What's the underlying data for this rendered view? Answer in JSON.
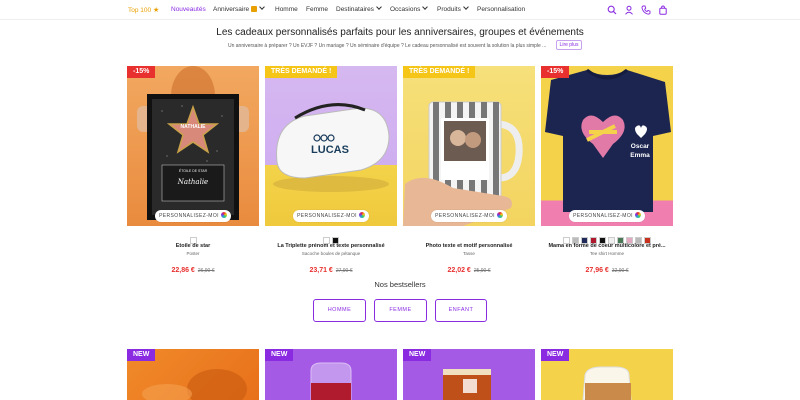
{
  "nav": {
    "top100": "Top 100",
    "new": "Nouveautés",
    "items": [
      "Anniversaire",
      "Homme",
      "Femme",
      "Destinataires",
      "Occasions",
      "Produits",
      "Personnalisation"
    ]
  },
  "icons": [
    "search-icon",
    "user-icon",
    "phone-icon",
    "cart-icon"
  ],
  "hero": {
    "title": "Les cadeaux personnalisés parfaits pour les anniversaires, groupes et événements",
    "subtitle": "Un anniversaire à préparer ? Un EVJF ? Un mariage ? Un séminaire d'équipe ? Le cadeau personnalisé est souvent la solution la plus simple ...",
    "more": "Lire plus"
  },
  "products": [
    {
      "badge": "-15%",
      "badge_color": "#e8312f",
      "personalize": "PERSONNALISEZ-MOI",
      "name": "Etoile de star",
      "type": "Poster",
      "price": "22,86 €",
      "old_price": "26,90 €",
      "swatches": [
        "#ffffff"
      ],
      "art_name": "NATHALIE",
      "art_caption": "ÉTOILE DE STAR",
      "art_signature": "Nathalie"
    },
    {
      "badge": "TRÈS DEMANDÉ !",
      "badge_color": "#f5c518",
      "personalize": "PERSONNALISEZ-MOI",
      "name": "La Triplette prénom et texte personnalisé",
      "type": "Sacoche boules de pétanque",
      "price": "23,71 €",
      "old_price": "27,90 €",
      "swatches": [
        "#ffffff",
        "#111111"
      ],
      "art_name": "LUCAS"
    },
    {
      "badge": "TRÈS DEMANDÉ !",
      "badge_color": "#f5c518",
      "personalize": "PERSONNALISEZ-MOI",
      "name": "Photo texte et motif personnalisé",
      "type": "Tasse",
      "price": "22,02 €",
      "old_price": "25,90 €",
      "swatches": []
    },
    {
      "badge": "-15%",
      "badge_color": "#e8312f",
      "personalize": "PERSONNALISEZ-MOI",
      "name": "Mama en forme de coeur multicolore et pré...",
      "type": "Tee shirt Homme",
      "price": "27,96 €",
      "old_price": "32,90 €",
      "swatches": [
        "#ffffff",
        "#bbbbbb",
        "#1f2a5a",
        "#b0182e",
        "#111111",
        "#f0f0f0",
        "#4a7a55",
        "#e3a9c0",
        "#b9b9b9",
        "#c8301e"
      ],
      "art_line1": "Oscar",
      "art_line2": "Emma"
    }
  ],
  "bestsellers": {
    "title": "Nos bestsellers",
    "tabs": [
      "HOMME",
      "FEMME",
      "ENFANT"
    ]
  },
  "new_products": [
    {
      "badge": "NEW"
    },
    {
      "badge": "NEW"
    },
    {
      "badge": "NEW"
    },
    {
      "badge": "NEW"
    }
  ]
}
